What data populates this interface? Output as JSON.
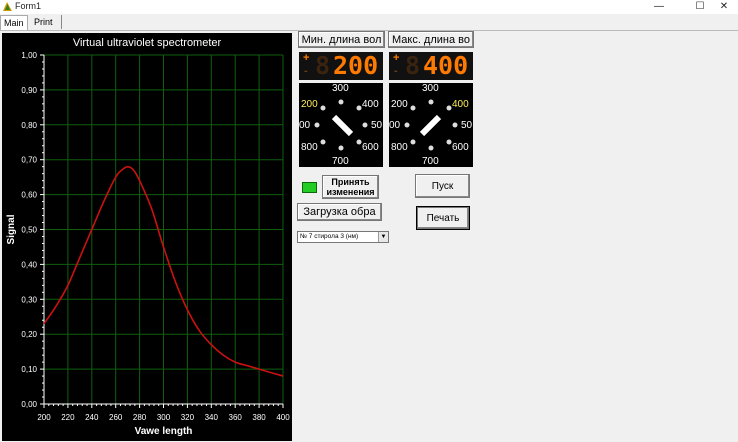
{
  "window": {
    "title": "Form1",
    "controls": {
      "minimize": "—",
      "maximize": "☐",
      "close": "✕"
    }
  },
  "tabs": [
    {
      "label": "Main"
    },
    {
      "label": "Print"
    }
  ],
  "chart": {
    "title": "Virtual ultraviolet spectrometer"
  },
  "lcd_min": {
    "plus": "+",
    "minus": "-",
    "ghost": "8",
    "digits": "200"
  },
  "lcd_max": {
    "plus": "+",
    "minus": "-",
    "ghost": "8",
    "digits": "400"
  },
  "buttons": {
    "min_wavelength": "Мин. длина вол",
    "max_wavelength": "Макс. длина во",
    "apply_changes_line1": "Принять",
    "apply_changes_line2": "изменения",
    "start": "Пуск",
    "load_sample": "Загрузка обра",
    "print": "Печать"
  },
  "knob_min": {
    "labels": {
      "top": "300",
      "left_top": "200",
      "left": "00",
      "right": "50",
      "right_top": "400",
      "left_bottom": "800",
      "right_bottom": "600",
      "bottom": "700"
    },
    "selected": "200"
  },
  "knob_max": {
    "labels": {
      "top": "300",
      "left_top": "200",
      "left": "00",
      "right": "50",
      "right_top": "400",
      "left_bottom": "800",
      "right_bottom": "600",
      "bottom": "700"
    },
    "selected": "400"
  },
  "sample_select": {
    "value": "№ 7 стирола 3 (нм)",
    "arrow": "▼"
  },
  "colors": {
    "curve": "#cc1111",
    "grid": "#0f5f0f",
    "led": "#22cc22",
    "lcd_digits": "#ff7a00"
  },
  "chart_data": {
    "type": "line",
    "title": "Virtual ultraviolet spectrometer",
    "xlabel": "Vawe length",
    "ylabel": "Signal",
    "xlim": [
      200,
      400
    ],
    "ylim": [
      0,
      1
    ],
    "x_ticks": [
      "200",
      "220",
      "240",
      "260",
      "280",
      "300",
      "320",
      "340",
      "360",
      "380",
      "400"
    ],
    "y_ticks": [
      "0,00",
      "0,10",
      "0,20",
      "0,30",
      "0,40",
      "0,50",
      "0,60",
      "0,70",
      "0,80",
      "0,90",
      "1,00"
    ],
    "grid": true,
    "series": [
      {
        "color": "#cc1111",
        "x": [
          200,
          210,
          220,
          230,
          240,
          250,
          260,
          265,
          270,
          275,
          280,
          290,
          300,
          310,
          320,
          330,
          340,
          350,
          360,
          370,
          380,
          390,
          400
        ],
        "y": [
          0.23,
          0.28,
          0.34,
          0.42,
          0.5,
          0.58,
          0.65,
          0.67,
          0.68,
          0.67,
          0.64,
          0.56,
          0.45,
          0.35,
          0.27,
          0.21,
          0.17,
          0.14,
          0.12,
          0.11,
          0.1,
          0.09,
          0.08
        ]
      }
    ]
  }
}
